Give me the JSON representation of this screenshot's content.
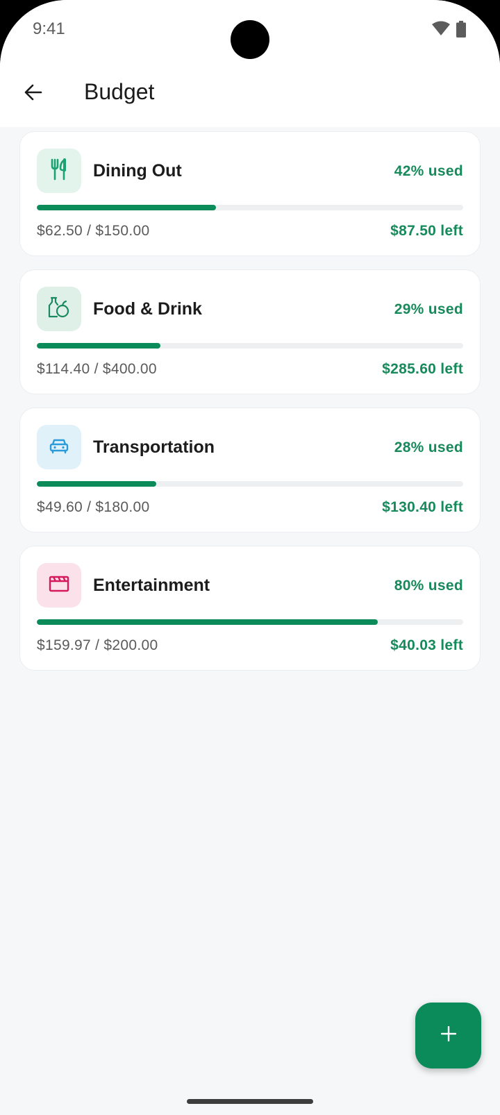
{
  "status_bar": {
    "time": "9:41"
  },
  "header": {
    "title": "Budget"
  },
  "colors": {
    "accent": "#0b8a5a",
    "accent_text": "#168a5b",
    "track": "#eeeff1"
  },
  "budgets": [
    {
      "name": "Dining Out",
      "icon": "utensils-icon",
      "icon_color": "#1aa272",
      "icon_bg": "#e2f4ec",
      "percent_label": "42% used",
      "progress": 0.42,
      "amount": "$62.50 / $150.00",
      "left": "$87.50 left"
    },
    {
      "name": "Food & Drink",
      "icon": "groceries-icon",
      "icon_color": "#1a8a5e",
      "icon_bg": "#dff0e8",
      "percent_label": "29% used",
      "progress": 0.29,
      "amount": "$114.40 / $400.00",
      "left": "$285.60 left"
    },
    {
      "name": "Transportation",
      "icon": "car-icon",
      "icon_color": "#2a9bd8",
      "icon_bg": "#e0f1fa",
      "percent_label": "28% used",
      "progress": 0.28,
      "amount": "$49.60 / $180.00",
      "left": "$130.40 left"
    },
    {
      "name": "Entertainment",
      "icon": "clapperboard-icon",
      "icon_color": "#d6195c",
      "icon_bg": "#fbe2ea",
      "percent_label": "80% used",
      "progress": 0.8,
      "amount": "$159.97 / $200.00",
      "left": "$40.03 left"
    }
  ],
  "fab": {
    "icon": "plus-icon"
  }
}
